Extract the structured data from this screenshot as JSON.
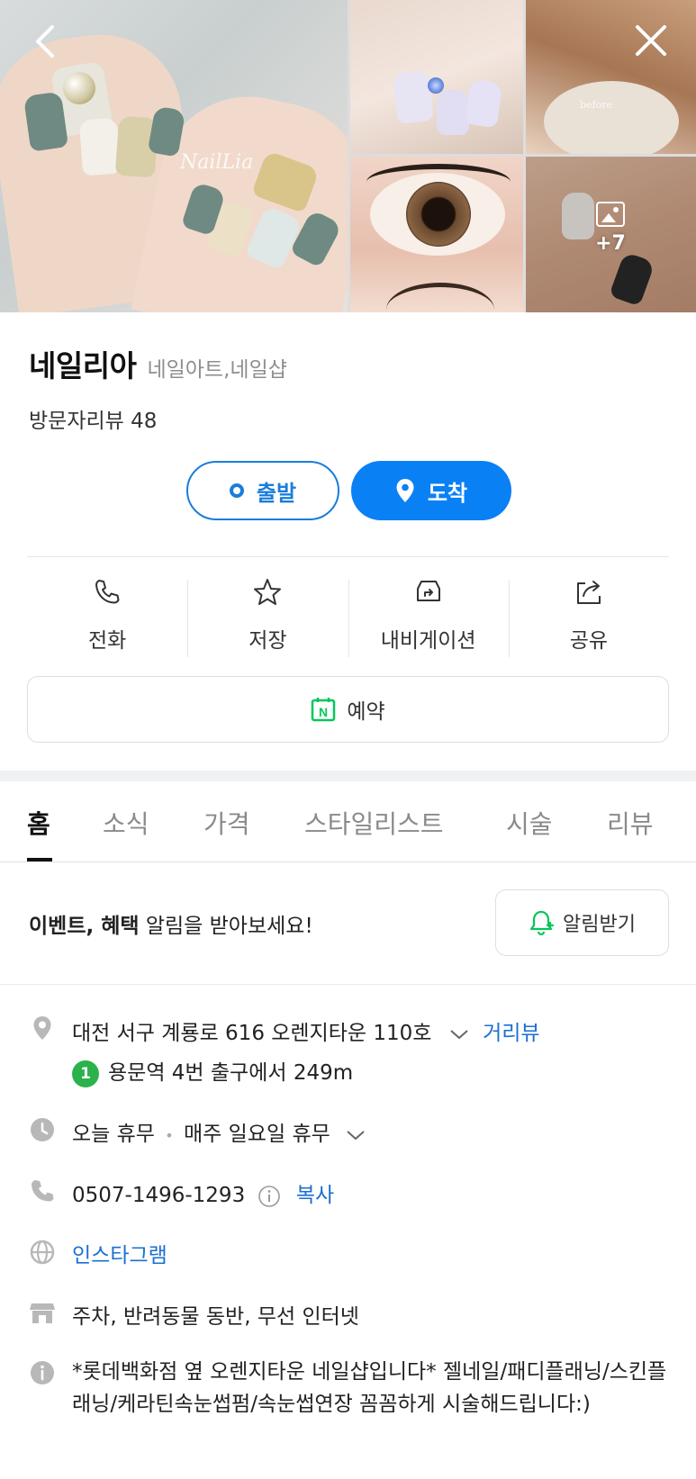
{
  "gallery": {
    "more_count": "+7",
    "watermark_main": "NailLia",
    "watermark_before": "before"
  },
  "header": {
    "name": "네일리아",
    "category": "네일아트,네일샵",
    "review_label": "방문자리뷰 48"
  },
  "route": {
    "depart_label": "출발",
    "arrive_label": "도착"
  },
  "actions": [
    {
      "label": "전화",
      "icon": "phone-icon"
    },
    {
      "label": "저장",
      "icon": "star-icon"
    },
    {
      "label": "내비게이션",
      "icon": "navigation-icon"
    },
    {
      "label": "공유",
      "icon": "share-icon"
    }
  ],
  "reserve": {
    "label": "예약",
    "icon_letter": "N"
  },
  "tabs": [
    "홈",
    "소식",
    "가격",
    "스타일리스트",
    "시술",
    "리뷰"
  ],
  "alert": {
    "text_bold": "이벤트, 혜택",
    "text_rest": " 알림을 받아보세요!",
    "button_label": "알림받기"
  },
  "info": {
    "address": "대전 서구 계룡로 616 오렌지타운 110호",
    "street_view": "거리뷰",
    "subway_line": "1",
    "subway_text": "용문역 4번 출구에서 249m",
    "hours_status": "오늘 휴무",
    "hours_sep": "•",
    "hours_detail": "매주 일요일 휴무",
    "phone": "0507-1496-1293",
    "copy_label": "복사",
    "instagram": "인스타그램",
    "amenities": "주차, 반려동물 동반, 무선 인터넷",
    "description": "*롯데백화점 옆 오렌지타운 네일샵입니다* 젤네일/패디플래닝/스킨플래닝/케라틴속눈썹펌/속눈썹연장 꼼꼼하게 시술해드립니다:)"
  },
  "colors": {
    "accent_blue": "#0a80f5",
    "link_blue": "#1a6fd1",
    "naver_green": "#03c75a",
    "subway_green": "#2bb24c"
  }
}
